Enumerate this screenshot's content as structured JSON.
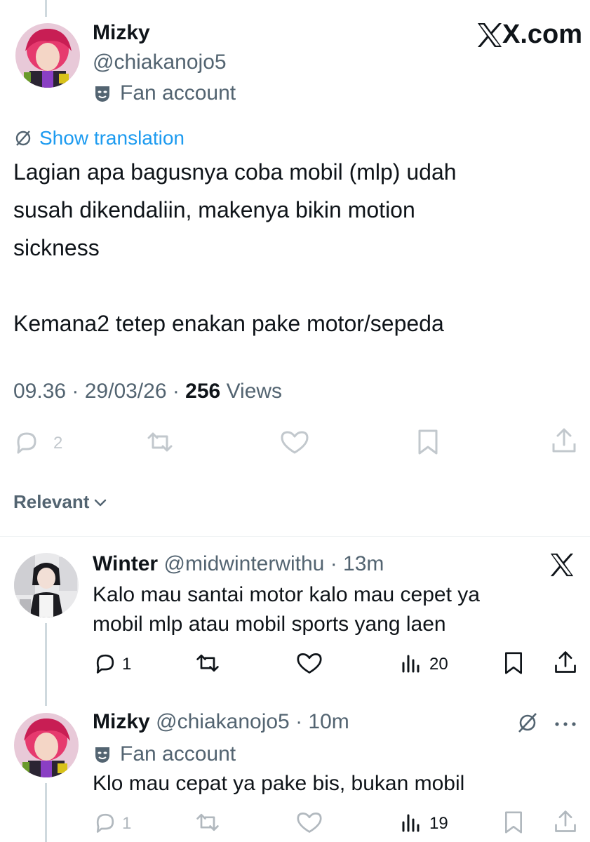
{
  "main_tweet": {
    "name": "Mizky",
    "handle": "@chiakanojo5",
    "badge": "Fan account",
    "brand": "X.com",
    "show_translation": "Show translation",
    "text_line1": "Lagian apa bagusnya coba mobil (mlp) udah",
    "text_line2": "susah dikendaliin, makenya bikin motion",
    "text_line3": "sickness",
    "text_line4": "Kemana2 tetep enakan pake motor/sepeda",
    "meta_prefix": "09.36 · 29/03/26 · ",
    "views_count": "256",
    "views_label": " Views",
    "reply_count": "2"
  },
  "sort": {
    "label": "Relevant"
  },
  "replies": [
    {
      "name": "Winter",
      "handle": "@midwinterwithu",
      "time": " · 13m",
      "text_line1": "Kalo mau santai motor kalo mau cepet ya",
      "text_line2": "mobil mlp atau mobil sports yang laen",
      "reply_count": "1",
      "views": "20"
    },
    {
      "name": "Mizky",
      "handle": "@chiakanojo5",
      "time": " · 10m",
      "badge": "Fan account",
      "text_line1": "Klo mau cepat ya pake bis, bukan mobil",
      "reply_count": "1",
      "views": "19"
    }
  ],
  "colors": {
    "accent": "#1d9bf0",
    "text": "#0f1419",
    "secondary": "#536471",
    "line": "#cfd9de"
  },
  "icons": [
    "reply-icon",
    "retweet-icon",
    "like-icon",
    "bookmark-icon",
    "share-icon",
    "views-icon",
    "grok-icon",
    "more-icon",
    "x-logo-icon",
    "theater-mask-icon",
    "translate-icon",
    "chevron-down-icon"
  ]
}
